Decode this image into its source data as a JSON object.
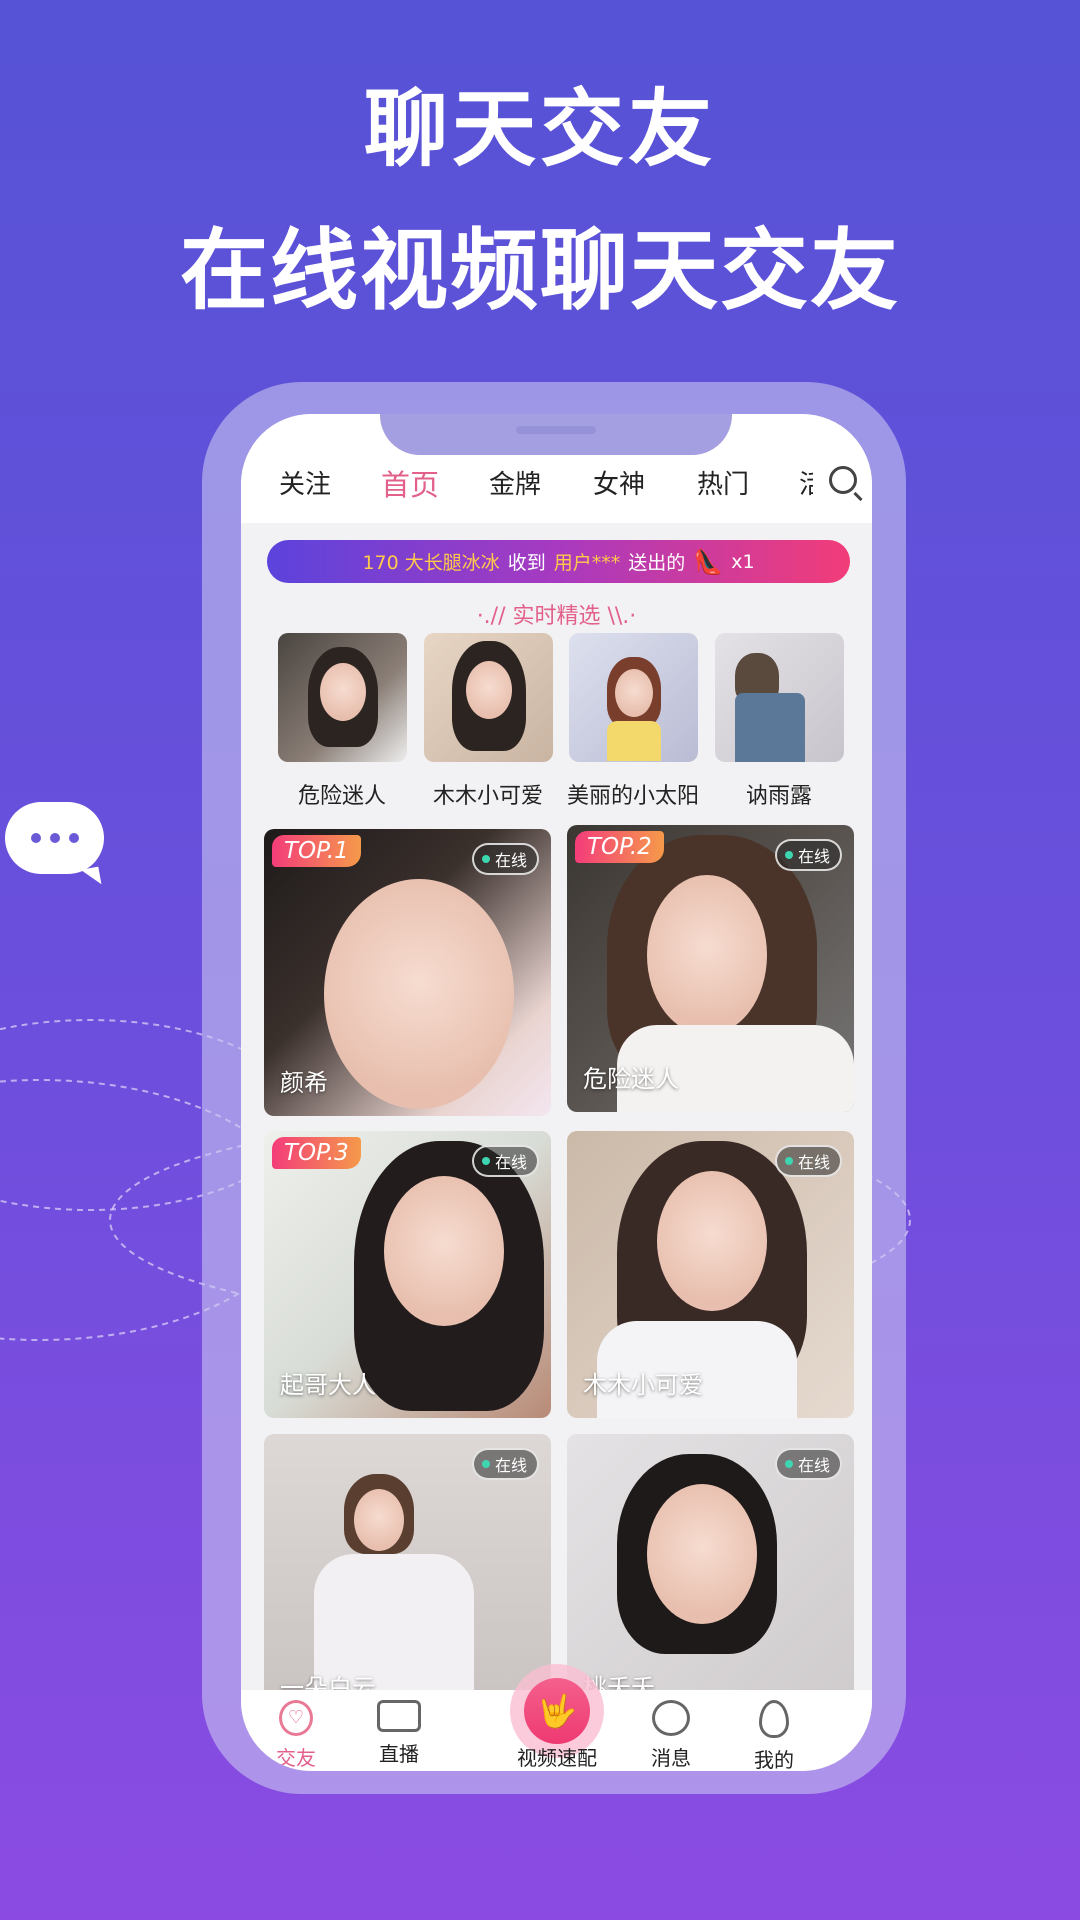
{
  "promo": {
    "title": "聊天交友",
    "subtitle": "在线视频聊天交友"
  },
  "tabs": [
    {
      "label": "关注"
    },
    {
      "label": "首页",
      "active": true
    },
    {
      "label": "金牌"
    },
    {
      "label": "女神"
    },
    {
      "label": "热门"
    },
    {
      "label": "活"
    }
  ],
  "search_icon": "search-icon",
  "banner": {
    "sender_target": "170 大长腿冰冰",
    "received": "收到",
    "user": "用户***",
    "sent": "送出的",
    "gift_icon": "high-heel-icon",
    "count": "x1"
  },
  "featured": {
    "title": "·.// 实时精选 \\\\.·",
    "items": [
      {
        "name": "危险迷人"
      },
      {
        "name": "木木小可爱"
      },
      {
        "name": "美丽的小太阳"
      },
      {
        "name": "讷雨露"
      }
    ]
  },
  "cards": [
    {
      "rank": "TOP.1",
      "status": "在线",
      "name": "颜希"
    },
    {
      "rank": "TOP.2",
      "status": "在线",
      "name": "危险迷人"
    },
    {
      "rank": "TOP.3",
      "status": "在线",
      "name": "起哥大人"
    },
    {
      "rank": "",
      "status": "在线",
      "name": "木木小可爱"
    },
    {
      "rank": "",
      "status": "在线",
      "name": "一朵白云"
    },
    {
      "rank": "",
      "status": "在线",
      "name": "桃夭夭"
    }
  ],
  "nav": [
    {
      "label": "交友",
      "icon": "heart-chat-icon",
      "active": true
    },
    {
      "label": "直播",
      "icon": "video-camera-icon"
    },
    {
      "label": "视频速配",
      "icon": "rock-hand-icon"
    },
    {
      "label": "消息",
      "icon": "chat-bubble-icon"
    },
    {
      "label": "我的",
      "icon": "egg-icon"
    }
  ],
  "colors": {
    "accent": "#e2608a",
    "bg_top": "#5653d6",
    "bg_bottom": "#8b4be2",
    "online": "#3dd6b0"
  }
}
